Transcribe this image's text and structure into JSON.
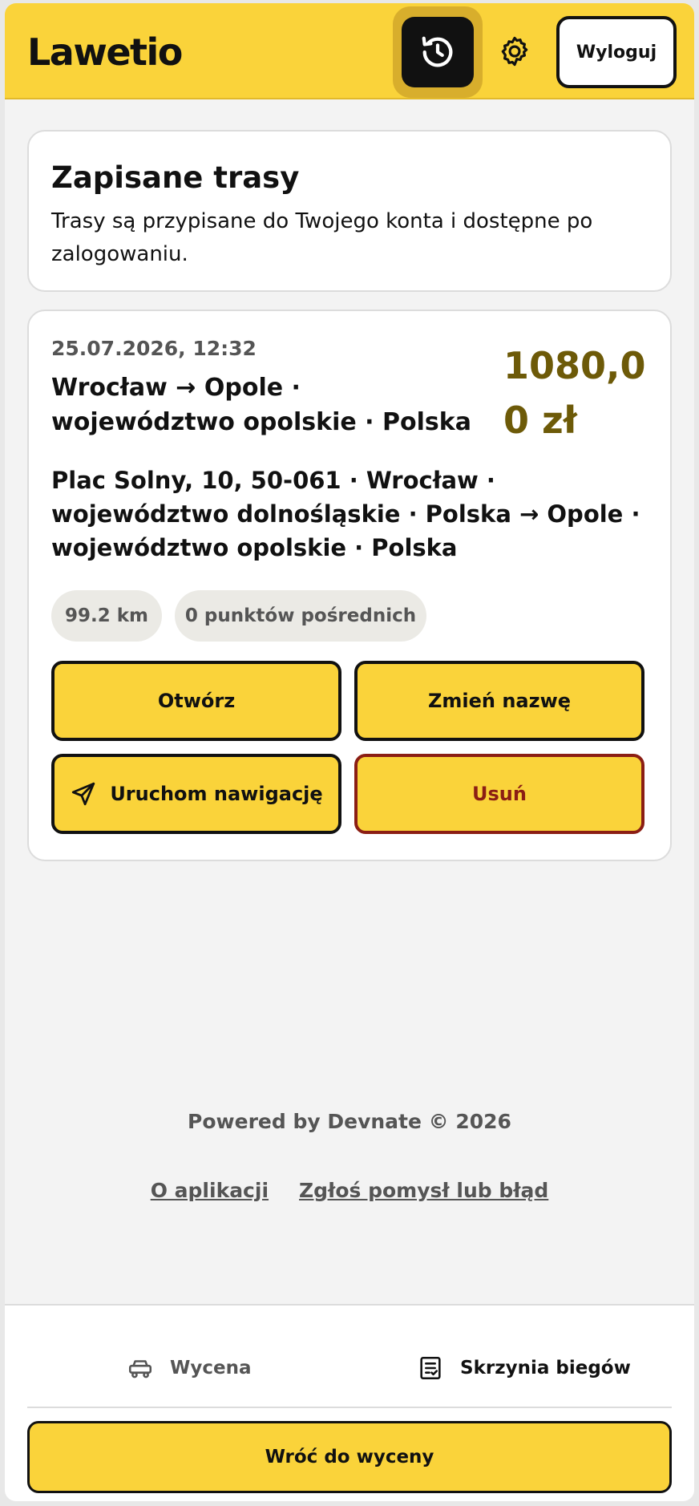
{
  "header": {
    "logo": "Lawetio",
    "history_icon": "history-icon",
    "settings_icon": "gear-icon",
    "logout_label": "Wyloguj"
  },
  "info": {
    "title": "Zapisane trasy",
    "text": "Trasy są przypisane do Twojego konta i dostępne po zalogowaniu."
  },
  "route": {
    "date": "25.07.2026, 12:32",
    "title": "Wrocław → Opole · województwo opolskie · Polska",
    "price": "1080,00 zł",
    "address": "Plac Solny, 10, 50-061 · Wrocław · województwo dolnośląskie · Polska → Opole · województwo opolskie · Polska",
    "distance": "99.2 km",
    "waypoints": "0 punktów pośrednich",
    "open_label": "Otwórz",
    "rename_label": "Zmień nazwę",
    "navigate_label": "Uruchom nawigację",
    "delete_label": "Usuń"
  },
  "footer": {
    "powered": "Powered by Devnate © 2026",
    "about_link": "O aplikacji",
    "report_link": "Zgłoś pomysł lub błąd"
  },
  "bottom_nav": {
    "tab_wycena": "Wycena",
    "tab_skrzynia": "Skrzynia biegów",
    "back_label": "Wróć do wyceny"
  },
  "colors": {
    "accent": "#fad33a",
    "price": "#6d5a08",
    "danger": "#8b1e14",
    "background": "#f3f3f3"
  }
}
